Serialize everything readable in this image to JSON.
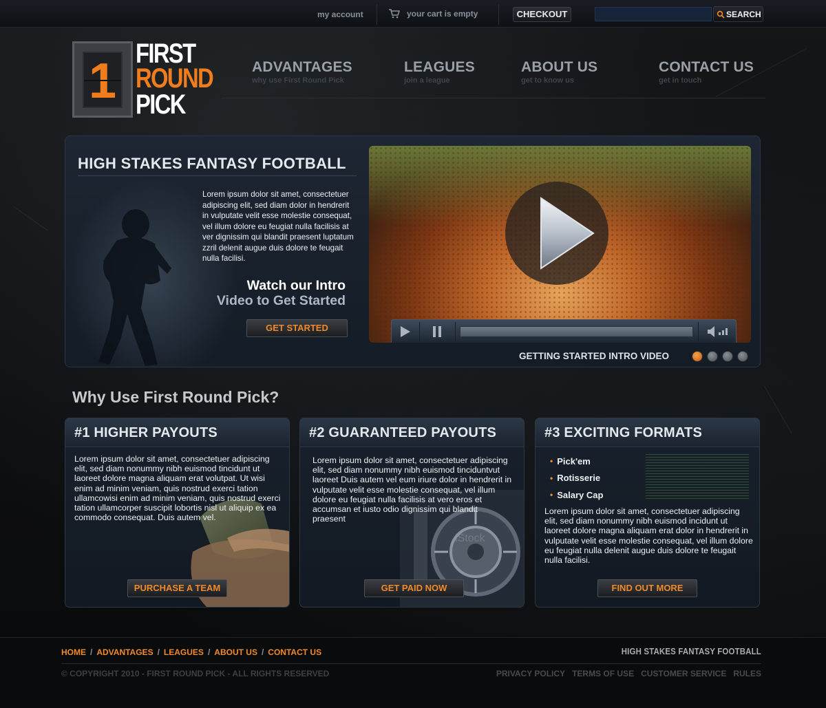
{
  "topbar": {
    "my_account": "my account",
    "cart_status": "your cart is empty",
    "checkout_label": "CHECKOUT",
    "search_value": "",
    "search_label": "SEARCH"
  },
  "logo": {
    "number": "1",
    "line1": "FIRST",
    "line2": "ROUND",
    "line3": "PICK"
  },
  "nav": [
    {
      "label": "ADVANTAGES",
      "sub": "why use First Round Pick"
    },
    {
      "label": "LEAGUES",
      "sub": "join a league"
    },
    {
      "label": "ABOUT US",
      "sub": "get to know us"
    },
    {
      "label": "CONTACT US",
      "sub": "get in touch"
    }
  ],
  "hero": {
    "title": "HIGH STAKES FANTASY FOOTBALL",
    "body": "Lorem ipsum dolor sit amet, consectetuer adipiscing elit, sed diam dolor in hendrerit in vulputate velit esse molestie consequat, vel illum dolore eu feugiat nulla facilisis at ver dignissim qui blandit praesent luptatum zzril delenit augue duis dolore te feugait nulla facilisi.",
    "cta_line1": "Watch our Intro",
    "cta_line2": "Video to Get Started",
    "button_label": "GET STARTED",
    "video_caption": "GETTING STARTED INTRO VIDEO",
    "video_progress": 0.0,
    "slides_total": 4,
    "slide_active": 1
  },
  "why": {
    "title": "Why Use First Round Pick?",
    "cards": [
      {
        "title": "#1 HIGHER PAYOUTS",
        "body": "Lorem ipsum dolor sit amet, consectetuer adipiscing elit, sed diam nonummy nibh euismod tincidunt ut laoreet dolore magna aliquam erat volutpat. Ut wisi enim ad minim veniam, quis nostrud exerci tation ullamcowisi enim ad minim veniam, quis nostrud exerci tation ullamcorper suscipit lobortis nisl ut aliquip ex ea commodo consequat. Duis autem vel.",
        "button": "PURCHASE A TEAM"
      },
      {
        "title": "#2 GUARANTEED PAYOUTS",
        "body": "Lorem ipsum dolor sit amet, consectetuer adipiscing elit, sed diam nonummy nibh euismod tinciduntvut laoreet Duis autem vel eum iriure dolor in hendrerit in vulputate velit esse molestie consequat, vel illum dolore eu feugiat nulla facilisis at vero eros et accumsan et iusto odio dignissim qui blandit praesent",
        "button": "GET PAID NOW",
        "watermark": "iStock"
      },
      {
        "title": "#3 EXCITING FORMATS",
        "formats": [
          "Pick'em",
          "Rotisserie",
          "Salary Cap"
        ],
        "body": "Lorem ipsum dolor sit amet, consectetuer adipiscing elit, sed diam nonummy nibh euismod incidunt ut laoreet dolore magna aliquam erat dolor in hendrerit in vulputate velit esse molestie consequat, vel illum dolore eu feugiat nulla delenit augue duis dolore te feugait nulla facilisi.",
        "button": "FIND OUT MORE"
      }
    ]
  },
  "footer": {
    "links": [
      "HOME",
      "ADVANTAGES",
      "LEAGUES",
      "ABOUT US",
      "CONTACT US"
    ],
    "tagline": "HIGH STAKES FANTASY FOOTBALL",
    "copyright": "© COPYRIGHT 2010 - FIRST ROUND PICK - ALL RIGHTS RESERVED",
    "legal": [
      "PRIVACY POLICY",
      "TERMS OF USE",
      "CUSTOMER SERVICE",
      "RULES"
    ]
  },
  "colors": {
    "accent": "#f28a2a",
    "panel": "#18212c",
    "background": "#0b0c0d"
  }
}
